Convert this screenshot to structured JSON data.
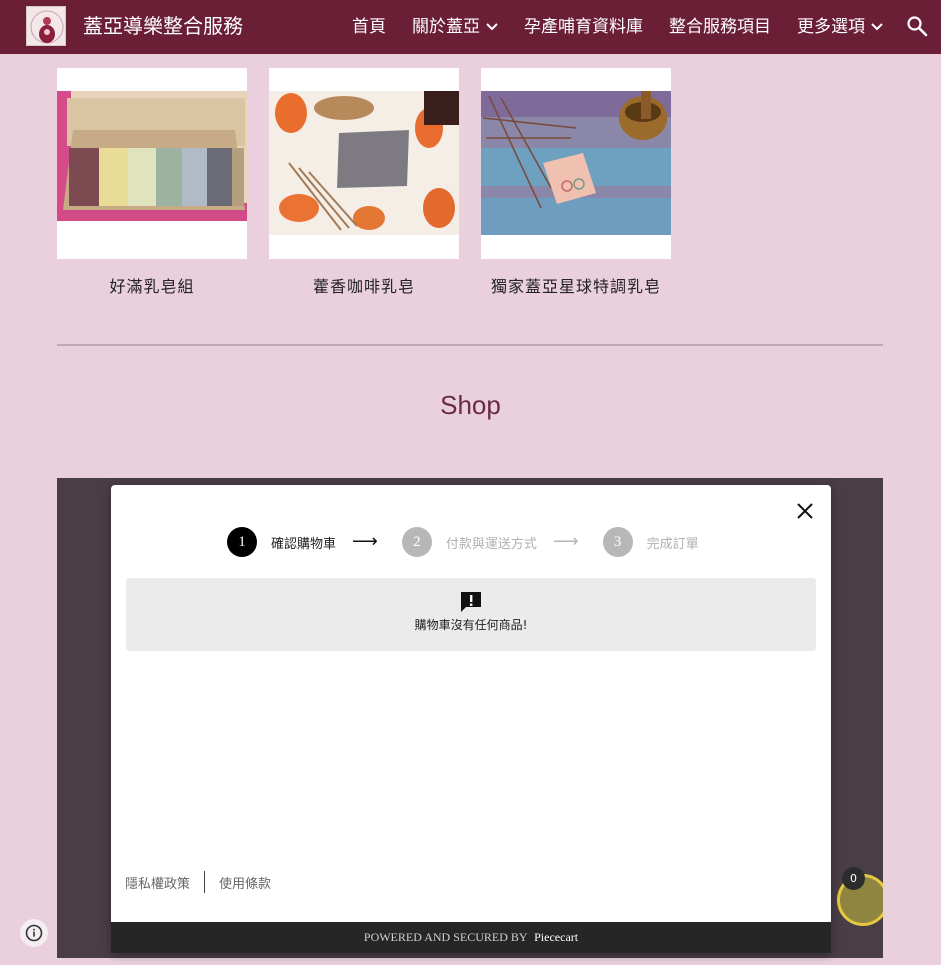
{
  "header": {
    "site_title": "蓋亞導樂整合服務",
    "nav": [
      {
        "label": "首頁",
        "dropdown": false
      },
      {
        "label": "關於蓋亞",
        "dropdown": true
      },
      {
        "label": "孕產哺育資料庫",
        "dropdown": false
      },
      {
        "label": "整合服務項目",
        "dropdown": false
      },
      {
        "label": "更多選項",
        "dropdown": true
      }
    ],
    "icons": {
      "search": "search-icon",
      "dropdown": "chevron-down-icon"
    }
  },
  "products": [
    {
      "name": "好滿乳皂組"
    },
    {
      "name": "藿香咖啡乳皂"
    },
    {
      "name": "獨家蓋亞星球特調乳皂"
    }
  ],
  "shop": {
    "title": "Shop",
    "checkout": {
      "steps": [
        {
          "number": "1",
          "label": "確認購物車",
          "state": "active"
        },
        {
          "number": "2",
          "label": "付款與運送方式",
          "state": "inactive"
        },
        {
          "number": "3",
          "label": "完成訂單",
          "state": "inactive"
        }
      ],
      "empty_message": "購物車沒有任何商品!",
      "links": {
        "privacy": "隱私權政策",
        "terms": "使用條款"
      },
      "footer": {
        "powered_text": "POWERED AND SECURED BY",
        "brand": "Piececart"
      }
    },
    "cart_count": "0"
  },
  "colors": {
    "header_bg": "#6a1f36",
    "page_bg": "#ead0dd",
    "shop_title": "#6a2a43",
    "frame_bg": "#4a3e46"
  }
}
